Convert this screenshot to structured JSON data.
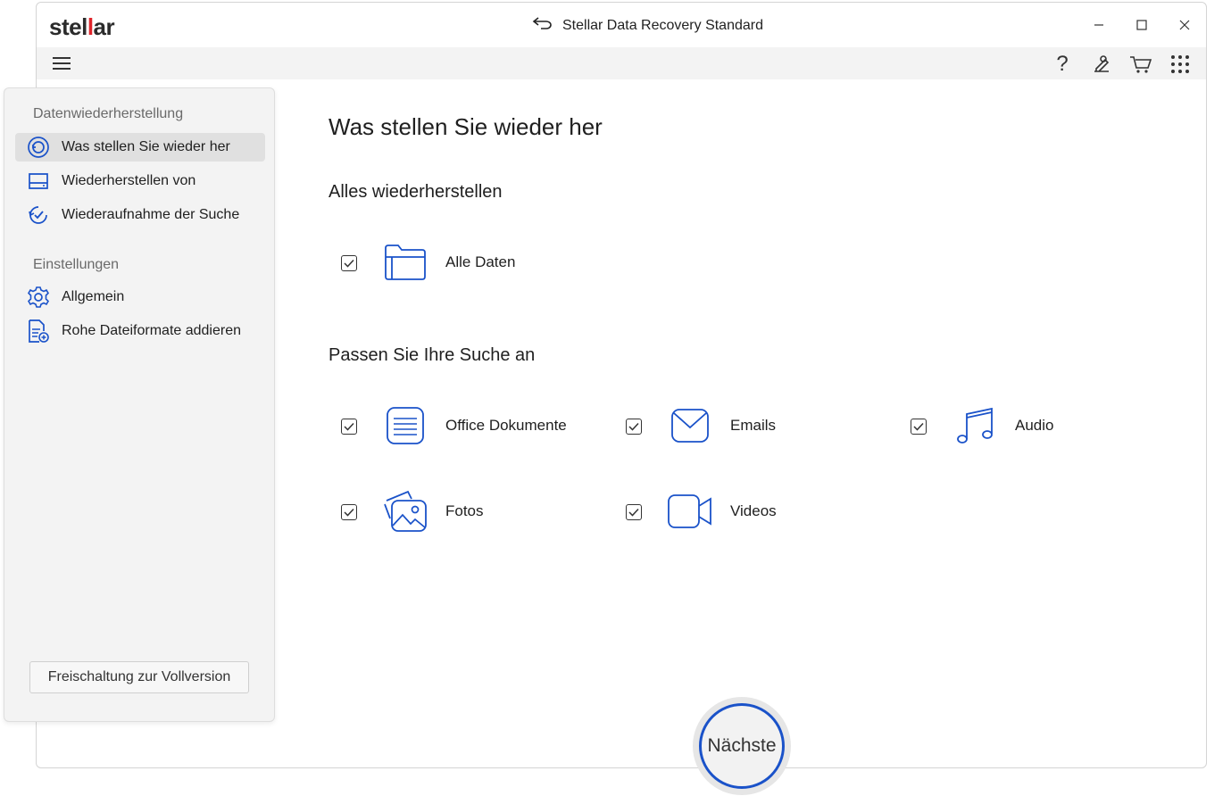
{
  "app": {
    "logo": {
      "pre": "stel",
      "mid": "l",
      "post": "ar"
    },
    "title": "Stellar Data Recovery Standard"
  },
  "colors": {
    "accent": "#1a52c9",
    "logo_red": "#e0252b",
    "sidebar_bg": "#f3f3f3"
  },
  "toolbar": {
    "icons": [
      "menu-icon",
      "help-icon",
      "wrench-icon",
      "cart-icon",
      "apps-grid-icon"
    ],
    "help_glyph": "?"
  },
  "sidebar": {
    "section1": "Datenwiederherstellung",
    "items1": [
      {
        "label": "Was stellen Sie wieder her",
        "icon": "restore-icon",
        "active": true
      },
      {
        "label": "Wiederherstellen von",
        "icon": "drive-icon",
        "active": false
      },
      {
        "label": "Wiederaufnahme der Suche",
        "icon": "resume-icon",
        "active": false
      }
    ],
    "section2": "Einstellungen",
    "items2": [
      {
        "label": "Allgemein",
        "icon": "gear-icon"
      },
      {
        "label": "Rohe Dateiformate addieren",
        "icon": "add-file-icon"
      }
    ],
    "upgrade_label": "Freischaltung zur Vollversion"
  },
  "main": {
    "title": "Was stellen Sie wieder her",
    "all_section": "Alles wiederherstellen",
    "all_option": {
      "label": "Alle Daten",
      "checked": true,
      "icon": "folder-icon"
    },
    "custom_section": "Passen Sie Ihre Suche an",
    "options": [
      {
        "label": "Office Dokumente",
        "checked": true,
        "icon": "document-icon"
      },
      {
        "label": "Emails",
        "checked": true,
        "icon": "email-icon"
      },
      {
        "label": "Audio",
        "checked": true,
        "icon": "music-icon"
      },
      {
        "label": "Fotos",
        "checked": true,
        "icon": "photos-icon"
      },
      {
        "label": "Videos",
        "checked": true,
        "icon": "video-icon"
      }
    ]
  },
  "next_button": "Nächste"
}
